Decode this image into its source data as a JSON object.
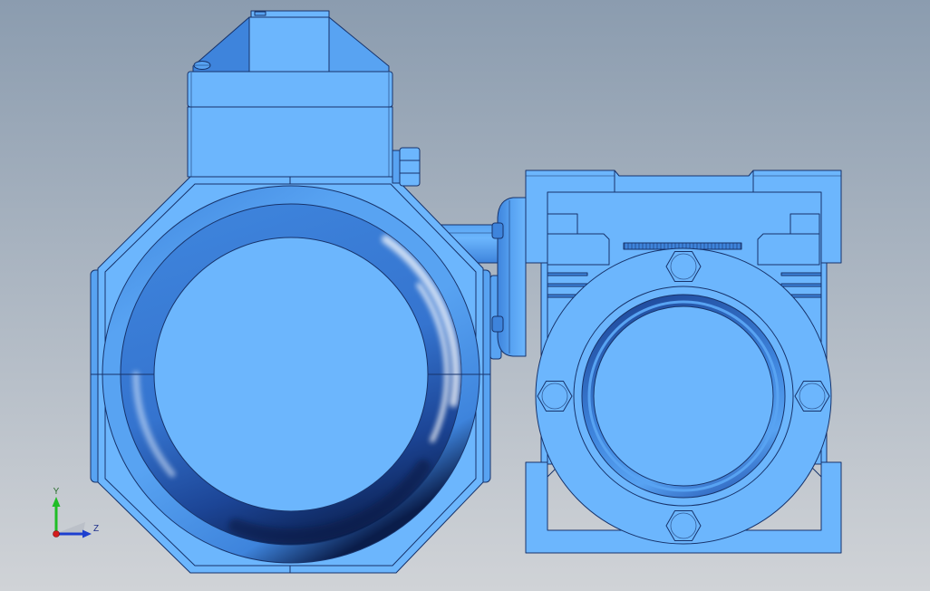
{
  "triad": {
    "y_label": "Y",
    "z_label": "Z"
  },
  "icons": {
    "view_orientation": "axis-triad-icon",
    "origin": "x-axis-dot-icon"
  },
  "colors": {
    "viewport_top": "#8b9caf",
    "viewport_bottom": "#d0d3d7",
    "model_face": "#6cb6fd",
    "model_face_mid": "#58a3f2",
    "model_shade": "#3e84dc",
    "model_deep": "#0a1d4a",
    "model_edge": "#17336b",
    "axis_x": "#d41c1c",
    "axis_y": "#1fbd26",
    "axis_z": "#1d3fcf"
  }
}
